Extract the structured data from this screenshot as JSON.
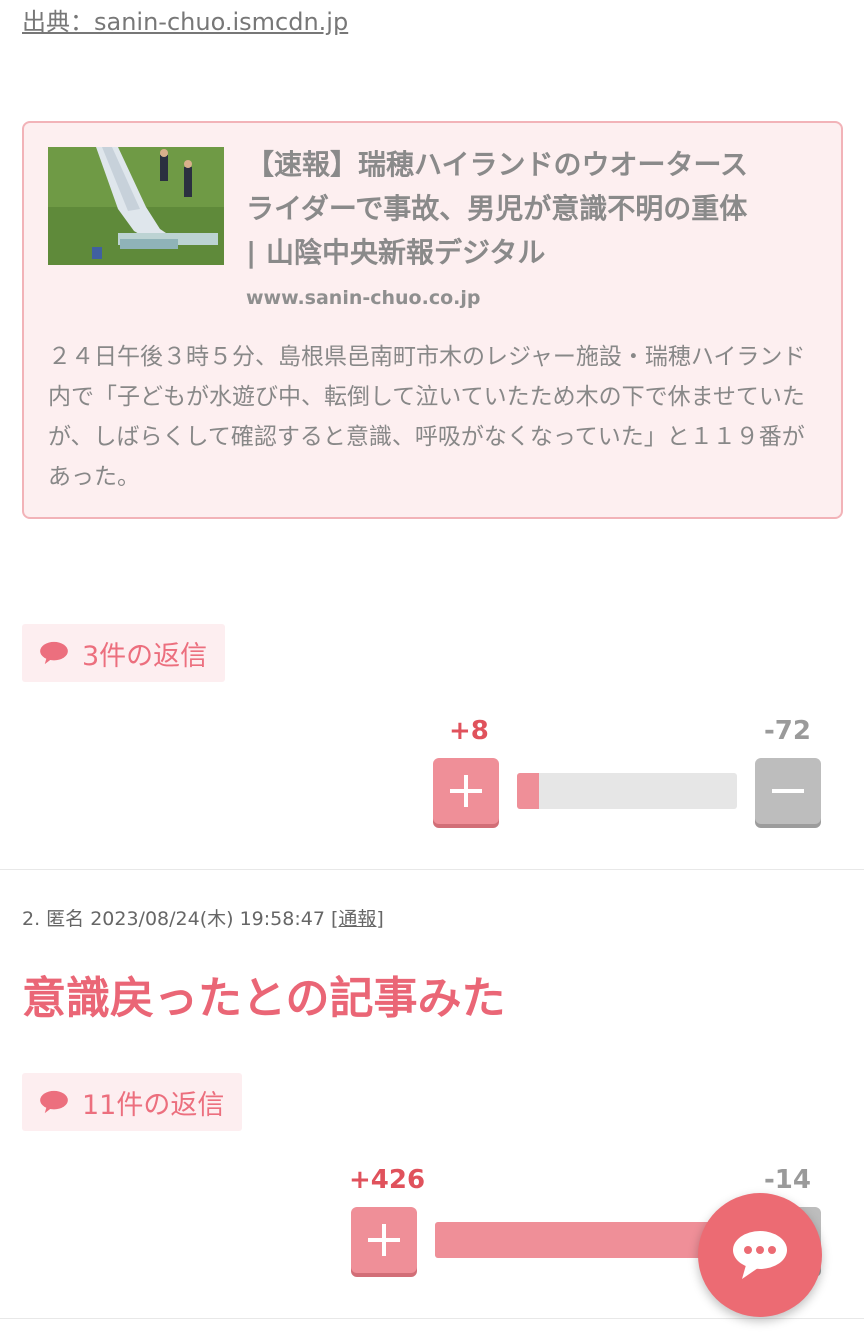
{
  "source": {
    "label": "出典：sanin-chuo.ismcdn.jp"
  },
  "link_card": {
    "title": "【速報】瑞穂ハイランドのウオータースライダーで事故、男児が意識不明の重体 | 山陰中央新報デジタル",
    "domain": "www.sanin-chuo.co.jp",
    "description": "２４日午後３時５分、島根県邑南町市木のレジャー施設・瑞穂ハイランド内で「子どもが水遊び中、転倒して泣いていたため木の下で休ませていたが、しばらくして確認すると意識、呼吸がなくなっていた」と１１９番があった。",
    "thumbnail_icon": "photo-water-slide"
  },
  "comment1": {
    "replies_label": "3件の返信",
    "plus_count": "+8",
    "minus_count": "-72",
    "plus_ratio": 0.1
  },
  "comment2": {
    "meta": "2. 匿名 2023/08/24(木) 19:58:47 ",
    "report_label": "[通報]",
    "text": "意識戻ったとの記事みた",
    "replies_label": "11件の返信",
    "plus_count": "+426",
    "minus_count": "-14",
    "plus_ratio": 0.97
  },
  "icons": {
    "reply": "speech-bubble-icon",
    "plus": "plus-icon",
    "minus": "minus-icon",
    "chat": "chat-bubble-icon"
  },
  "colors": {
    "accent": "#ec6f7e",
    "plus": "#ef8f98",
    "minus": "#bdbdbd",
    "card_bg": "#fdeff0"
  }
}
